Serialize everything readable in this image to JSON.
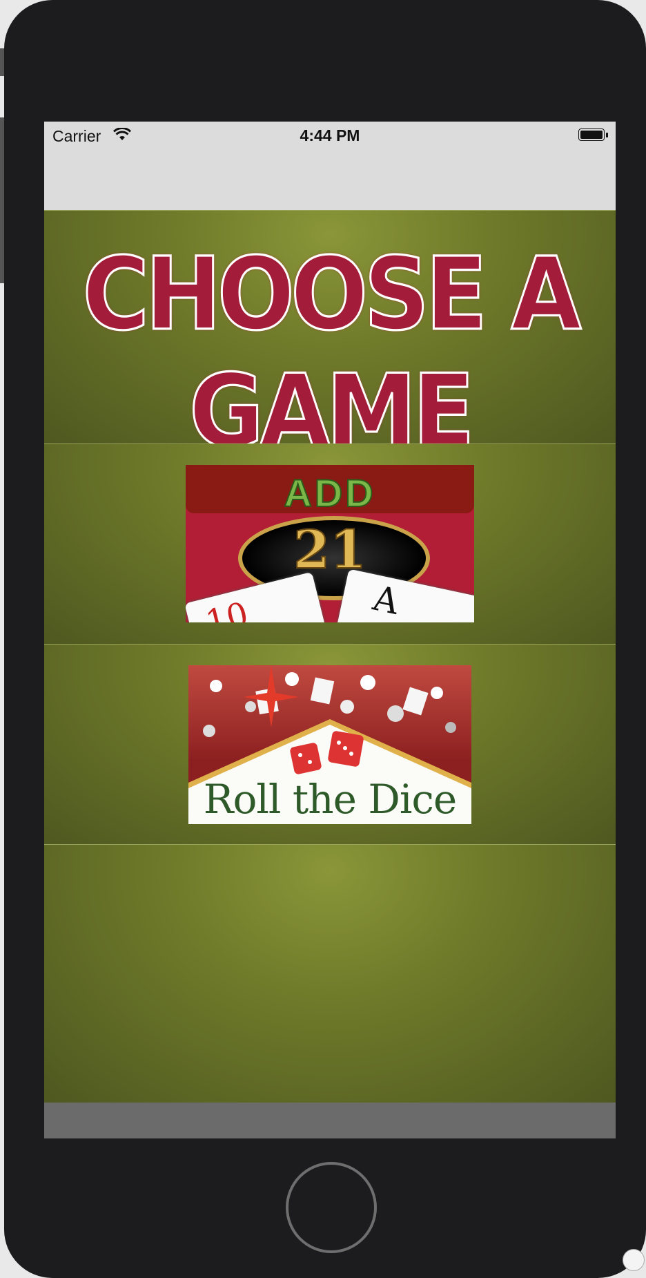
{
  "status_bar": {
    "carrier": "Carrier",
    "time": "4:44 PM",
    "icons": [
      "wifi-icon",
      "battery-icon"
    ]
  },
  "title_banner": {
    "text": "CHOOSE A GAME",
    "color": "#a31d3a"
  },
  "games": [
    {
      "name": "add21",
      "label_top": "ADD",
      "label_number": "21",
      "cards": [
        "10",
        "A"
      ]
    },
    {
      "name": "roll-the-dice",
      "label": "Roll the Dice"
    }
  ],
  "colors": {
    "felt": "#6f7a2a",
    "nav_bar": "#dcdcdc",
    "bottom_bar": "#6b6b6b",
    "device": "#1c1c1e"
  }
}
